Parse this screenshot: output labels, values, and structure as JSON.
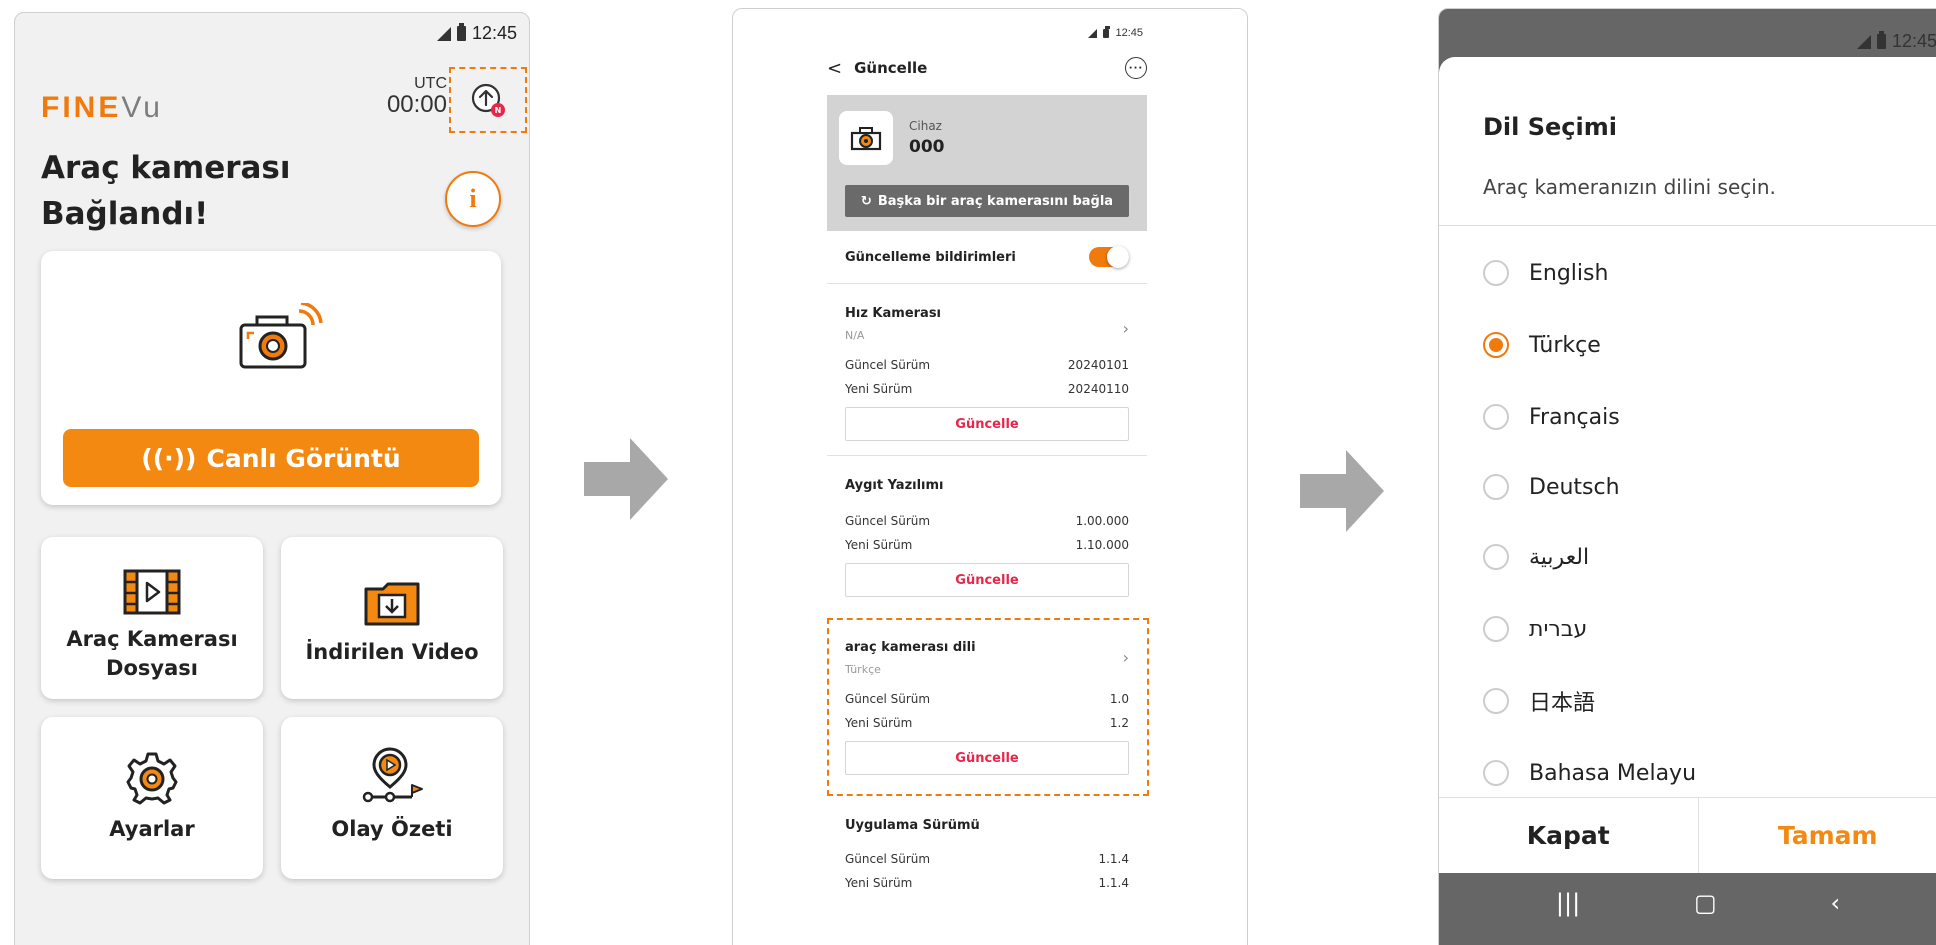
{
  "colors": {
    "brand": "#f07a0c",
    "update_text": "#e8264a",
    "arrow": "#a8a8a8"
  },
  "screen1": {
    "status_time": "12:45",
    "logo": {
      "part1": "FINE",
      "part2": "Vu"
    },
    "clock": {
      "label": "UTC",
      "time": "00:00"
    },
    "update_badge": "N",
    "title_line1": "Araç kamerası",
    "title_line2": "Bağlandı!",
    "info_icon": "i",
    "live_button": "Canlı Görüntü",
    "tiles": {
      "files_line1": "Araç Kamerası",
      "files_line2": "Dosyası",
      "downloads": "İndirilen Video",
      "settings": "Ayarlar",
      "events": "Olay Özeti"
    }
  },
  "screen2": {
    "status_time": "12:45",
    "header_title": "Güncelle",
    "device_label": "Cihaz",
    "device_name": "000",
    "connect_button": "Başka bir araç kamerasını bağla",
    "notifications_label": "Güncelleme bildirimleri",
    "sections": {
      "speedcam": {
        "title": "Hız Kamerası",
        "subtitle": "N/A",
        "current_label": "Güncel Sürüm",
        "current": "20240101",
        "new_label": "Yeni Sürüm",
        "new": "20240110",
        "button": "Güncelle"
      },
      "firmware": {
        "title": "Aygıt Yazılımı",
        "current_label": "Güncel Sürüm",
        "current": "1.00.000",
        "new_label": "Yeni Sürüm",
        "new": "1.10.000",
        "button": "Güncelle"
      },
      "language": {
        "title": "araç kamerası dili",
        "subtitle": "Türkçe",
        "current_label": "Güncel Sürüm",
        "current": "1.0",
        "new_label": "Yeni Sürüm",
        "new": "1.2",
        "button": "Güncelle"
      },
      "app": {
        "title": "Uygulama Sürümü",
        "current_label": "Güncel Sürüm",
        "current": "1.1.4",
        "new_label": "Yeni Sürüm",
        "new": "1.1.4"
      }
    }
  },
  "screen3": {
    "status_time": "12:45",
    "title": "Dil Seçimi",
    "subtitle": "Araç kameranızın dilini seçin.",
    "languages": [
      "English",
      "Türkçe",
      "Français",
      "Deutsch",
      "العربية",
      "עברית",
      "日本語",
      "Bahasa Melayu"
    ],
    "selected": "Türkçe",
    "close_button": "Kapat",
    "ok_button": "Tamam",
    "nav": {
      "recent": "|||",
      "home": "▢",
      "back": "‹"
    }
  }
}
